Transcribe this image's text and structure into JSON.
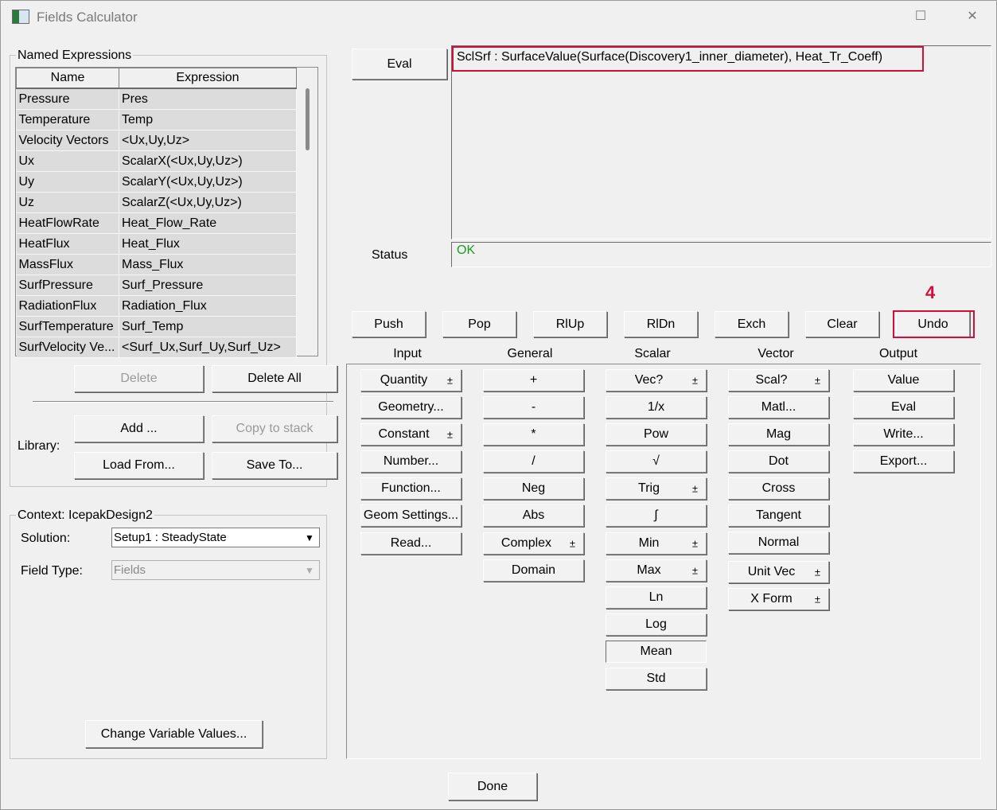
{
  "window": {
    "title": "Fields Calculator",
    "maximize_glyph": "☐",
    "close_glyph": "✕"
  },
  "named_expressions": {
    "label": "Named Expressions",
    "columns": [
      "Name",
      "Expression"
    ],
    "rows": [
      {
        "name": "Pressure",
        "expr": "Pres"
      },
      {
        "name": "Temperature",
        "expr": "Temp"
      },
      {
        "name": "Velocity Vectors",
        "expr": "<Ux,Uy,Uz>"
      },
      {
        "name": "Ux",
        "expr": "ScalarX(<Ux,Uy,Uz>)"
      },
      {
        "name": "Uy",
        "expr": "ScalarY(<Ux,Uy,Uz>)"
      },
      {
        "name": "Uz",
        "expr": "ScalarZ(<Ux,Uy,Uz>)"
      },
      {
        "name": "HeatFlowRate",
        "expr": "Heat_Flow_Rate"
      },
      {
        "name": "HeatFlux",
        "expr": "Heat_Flux"
      },
      {
        "name": "MassFlux",
        "expr": "Mass_Flux"
      },
      {
        "name": "SurfPressure",
        "expr": "Surf_Pressure"
      },
      {
        "name": "RadiationFlux",
        "expr": "Radiation_Flux"
      },
      {
        "name": "SurfTemperature",
        "expr": "Surf_Temp"
      },
      {
        "name": "SurfVelocity Ve...",
        "expr": "<Surf_Ux,Surf_Uy,Surf_Uz>"
      }
    ],
    "delete": "Delete",
    "delete_all": "Delete All",
    "library_label": "Library:",
    "add": "Add ...",
    "copy_to_stack": "Copy to stack",
    "load_from": "Load From...",
    "save_to": "Save To..."
  },
  "context": {
    "label": "Context: IcepakDesign2",
    "solution_label": "Solution:",
    "solution_value": "Setup1 : SteadyState",
    "field_type_label": "Field Type:",
    "field_type_value": "Fields",
    "change_vars": "Change Variable Values..."
  },
  "eval_button": "Eval",
  "stack_line": "SclSrf : SurfaceValue(Surface(Discovery1_inner_diameter), Heat_Tr_Coeff)",
  "status_label": "Status",
  "status_value": "OK",
  "annotation": "4",
  "highlight_color": "#d0103a",
  "status_color": "#1c9c1c",
  "stack_buttons": [
    "Push",
    "Pop",
    "RlUp",
    "RlDn",
    "Exch",
    "Clear",
    "Undo"
  ],
  "categories": [
    "Input",
    "General",
    "Scalar",
    "Vector",
    "Output"
  ],
  "input_buttons": [
    {
      "label": "Quantity",
      "arrow": true
    },
    {
      "label": "Geometry...",
      "arrow": false
    },
    {
      "label": "Constant",
      "arrow": true
    },
    {
      "label": "Number...",
      "arrow": false
    },
    {
      "label": "Function...",
      "arrow": false
    },
    {
      "label": "Geom Settings...",
      "arrow": false
    },
    {
      "label": "Read...",
      "arrow": false
    }
  ],
  "general_buttons": [
    {
      "label": "+",
      "arrow": false
    },
    {
      "label": "-",
      "arrow": false
    },
    {
      "label": "*",
      "arrow": false
    },
    {
      "label": "/",
      "arrow": false
    },
    {
      "label": "Neg",
      "arrow": false
    },
    {
      "label": "Abs",
      "arrow": false
    },
    {
      "label": "Complex",
      "arrow": true
    },
    {
      "label": "Domain",
      "arrow": false
    }
  ],
  "scalar_buttons": [
    {
      "label": "Vec?",
      "arrow": true
    },
    {
      "label": "1/x",
      "arrow": false
    },
    {
      "label": "Pow",
      "arrow": false
    },
    {
      "label": "√",
      "arrow": false
    },
    {
      "label": "Trig",
      "arrow": true
    },
    {
      "label": "∫",
      "arrow": false
    },
    {
      "label": "Min",
      "arrow": true
    },
    {
      "label": "Max",
      "arrow": true
    },
    {
      "label": "Ln",
      "arrow": false
    },
    {
      "label": "Log",
      "arrow": false
    },
    {
      "label": "Mean",
      "arrow": false
    },
    {
      "label": "Std",
      "arrow": false
    }
  ],
  "vector_buttons": [
    {
      "label": "Scal?",
      "arrow": true
    },
    {
      "label": "Matl...",
      "arrow": false
    },
    {
      "label": "Mag",
      "arrow": false
    },
    {
      "label": "Dot",
      "arrow": false
    },
    {
      "label": "Cross",
      "arrow": false
    },
    {
      "label": "Tangent",
      "arrow": false
    },
    {
      "label": "Normal",
      "arrow": false
    },
    {
      "label": "Unit Vec",
      "arrow": true
    },
    {
      "label": "X Form",
      "arrow": true
    }
  ],
  "output_buttons": [
    {
      "label": "Value",
      "arrow": false
    },
    {
      "label": "Eval",
      "arrow": false
    },
    {
      "label": "Write...",
      "arrow": false
    },
    {
      "label": "Export...",
      "arrow": false
    }
  ],
  "arrow_glyph": "±",
  "done": "Done"
}
